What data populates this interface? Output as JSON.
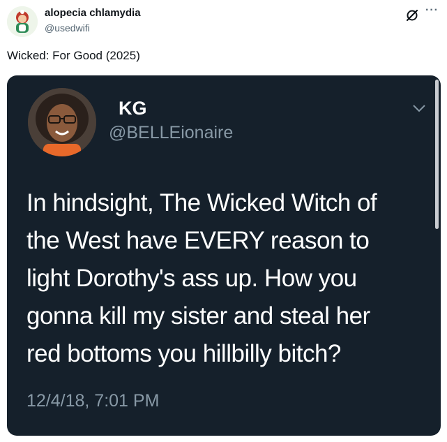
{
  "post": {
    "author_name": "alopecia chlamydia",
    "author_handle": "@usedwifi",
    "text": "Wicked: For Good (2025)",
    "more_icon": "more-icon",
    "grok_icon": "grok-icon"
  },
  "quoted_tweet": {
    "name": "KG",
    "handle": "@BELLEionaire",
    "lines": [
      "In hindsight, The Wicked Witch of",
      "the West have EVERY reason to",
      "light Dorothy's ass up. How you",
      "gonna kill my sister and steal her",
      "red bottoms you hillbilly bitch?"
    ],
    "timestamp": "12/4/18, 7:01 PM",
    "chevron_icon": "chevron-down-icon"
  },
  "colors": {
    "dark_bg": "#15202b",
    "secondary_text": "#8899a6",
    "handle_gray": "#536471"
  }
}
